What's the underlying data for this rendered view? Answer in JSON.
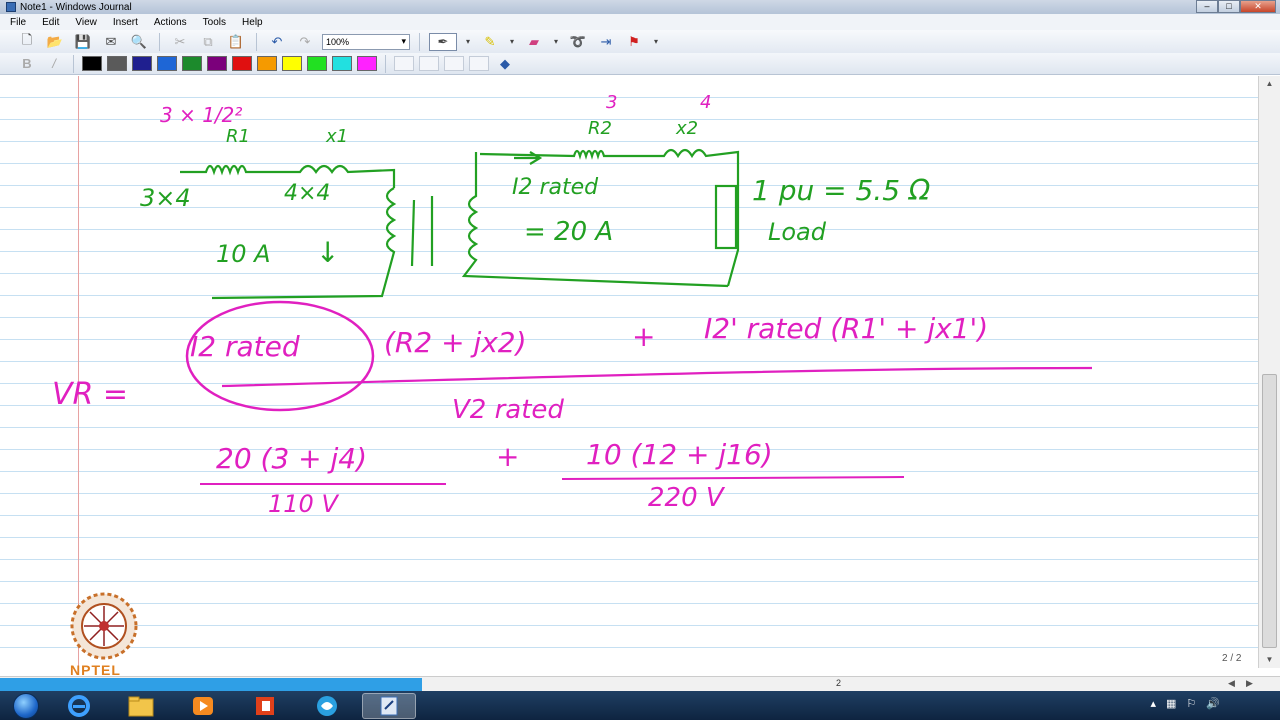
{
  "window": {
    "title": "Note1 - Windows Journal",
    "min": "–",
    "max": "□",
    "close": "✕"
  },
  "menu": [
    "File",
    "Edit",
    "View",
    "Insert",
    "Actions",
    "Tools",
    "Help"
  ],
  "toolbar": {
    "zoom_value": "100%"
  },
  "palette": [
    "#000000",
    "#5a5a5a",
    "#1f1f8f",
    "#1e66d6",
    "#1c8a2c",
    "#7b007b",
    "#e01010",
    "#f59a00",
    "#ffff00",
    "#22e022",
    "#22e0e0",
    "#ff22ff"
  ],
  "colors": {
    "pink_ink": "#e020c0",
    "green_ink": "#22a022",
    "scroll_accent": "#2f9fe6"
  },
  "page": {
    "counter": "2 / 2",
    "bottom_number": "2"
  },
  "logo": {
    "text": "NPTEL"
  },
  "handwriting": {
    "green": {
      "r1_label": "R1",
      "x1_label": "x1",
      "r1_value": "3×4",
      "x1_value": "4×4",
      "current": "10 A",
      "arrow": "↓",
      "r2_label": "R2",
      "x2_label": "x2",
      "i2_rated": "I2 rated",
      "i2_value": "= 20 A",
      "pu": "1 pu = 5.5 Ω",
      "load": "Load"
    },
    "pink": {
      "ratio": "3 × 1/2²",
      "r2_value": "3",
      "x2_value": "4",
      "vr_lhs": "VR =",
      "numerator_a": "I2 rated",
      "numerator_b": "(R2 + jx2)",
      "plus": "+",
      "numerator_c": "I2' rated (R1' + jx1')",
      "denominator": "V2 rated",
      "term1_num": "20 (3 + j4)",
      "term1_den": "110 V",
      "term2_num": "10 (12 + j16)",
      "term2_den": "220 V"
    }
  }
}
